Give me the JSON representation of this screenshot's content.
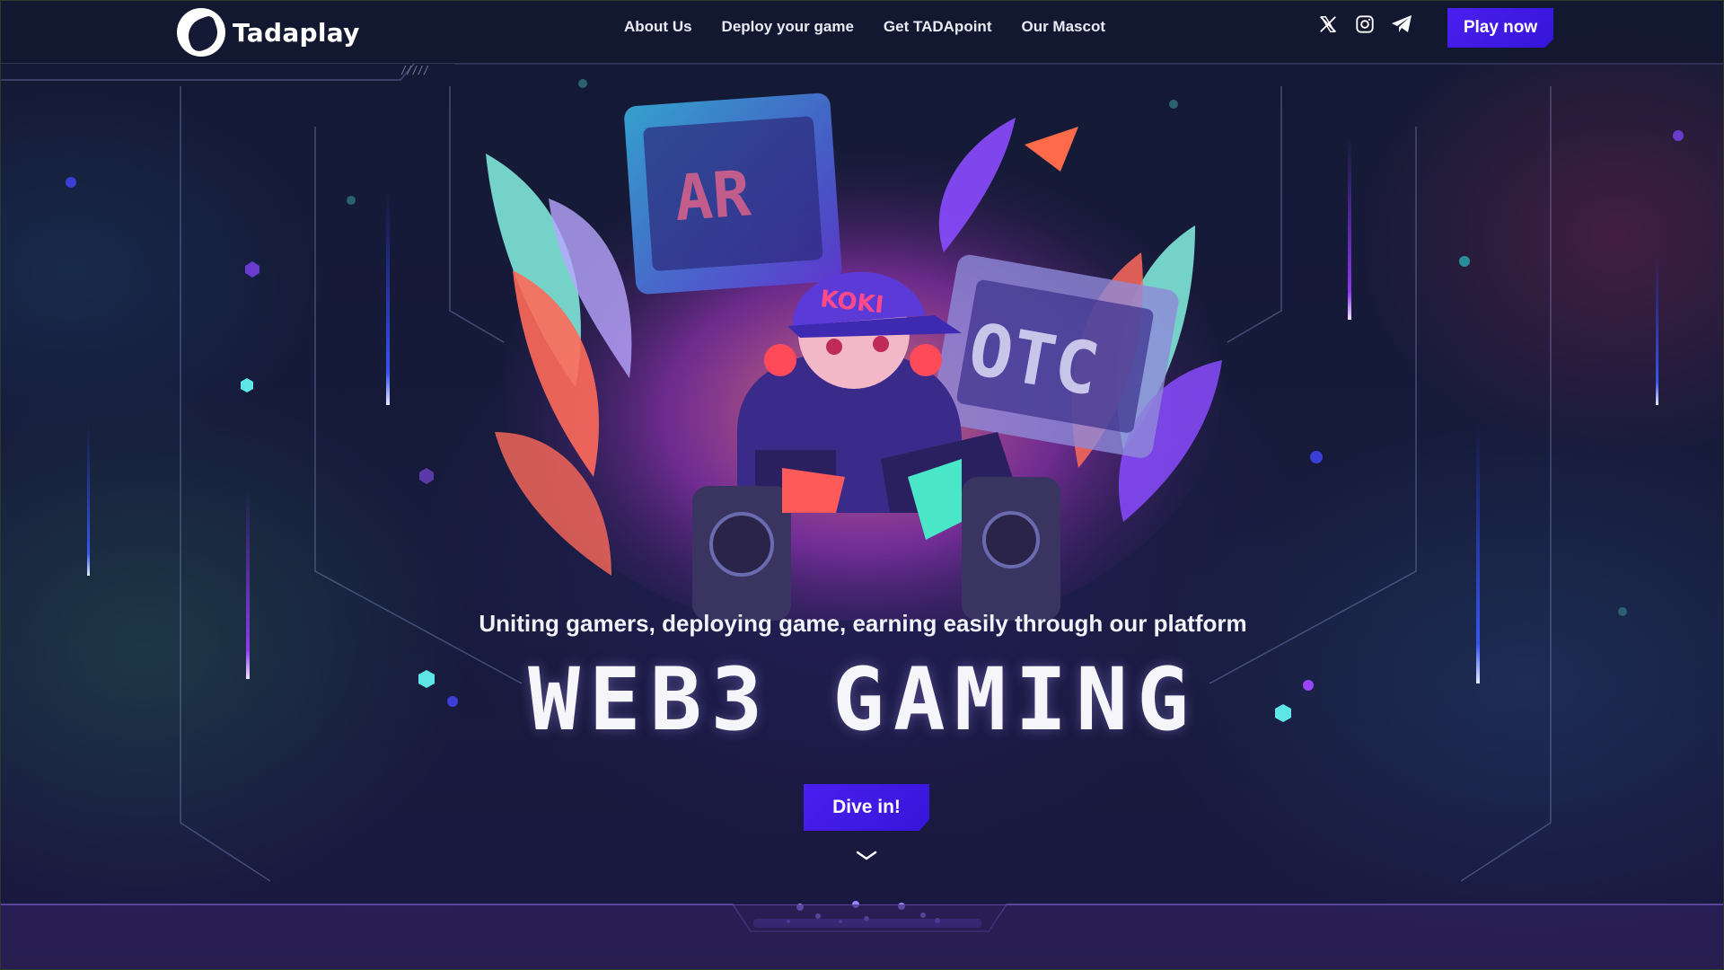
{
  "header": {
    "logo_text": "Tadaplay",
    "nav": [
      {
        "label": "About Us"
      },
      {
        "label": "Deploy your game"
      },
      {
        "label": "Get TADApoint"
      },
      {
        "label": "Our Mascot"
      }
    ],
    "socials": [
      {
        "icon": "x-twitter-icon"
      },
      {
        "icon": "instagram-icon"
      },
      {
        "icon": "telegram-icon"
      }
    ],
    "play_button": "Play now"
  },
  "hero": {
    "tagline": "Uniting gamers, deploying game, earning easily through our platform",
    "headline": "WEB3 GAMING",
    "cta": "Dive in!",
    "scroll_icon": "chevron-down-icon"
  },
  "colors": {
    "accent": "#4a1ff0",
    "background": "#141a35",
    "cyan": "#5ee6e6",
    "purple": "#8a4bff"
  }
}
